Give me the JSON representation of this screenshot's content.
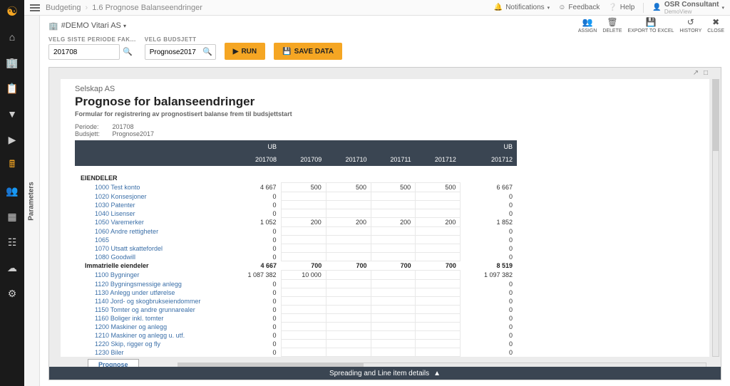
{
  "breadcrumb": {
    "root": "Budgeting",
    "page": "1.6 Prognose Balanseendringer"
  },
  "header_links": {
    "notifications": "Notifications",
    "feedback": "Feedback",
    "help": "Help"
  },
  "user": {
    "name": "OSR Consultant",
    "subtitle": "DemoView"
  },
  "entity": {
    "label": "#DEMO Vitari AS"
  },
  "toolbar": {
    "assign": "ASSIGN",
    "delete": "DELETE",
    "export": "EXPORT TO EXCEL",
    "history": "HISTORY",
    "close": "CLOSE"
  },
  "params_label": "Parameters",
  "filters": {
    "period_label": "VELG SISTE PERIODE FAK...",
    "period_value": "201708",
    "budget_label": "VELG BUDSJETT",
    "budget_value": "Prognose2017"
  },
  "buttons": {
    "run": "RUN",
    "save": "SAVE DATA"
  },
  "report": {
    "company": "Selskap AS",
    "title": "Prognose for balanseendringer",
    "subtitle": "Formular for registrering av prognostisert balanse frem til budsjettstart",
    "meta_period_label": "Periode:",
    "meta_period_value": "201708",
    "meta_budget_label": "Budsjett:",
    "meta_budget_value": "Prognose2017"
  },
  "columns": {
    "ub_start_top": "UB",
    "ub_start": "201708",
    "p1": "201709",
    "p2": "201710",
    "p3": "201711",
    "p4": "201712",
    "ub_end_top": "UB",
    "ub_end": "201712"
  },
  "section1": {
    "title": "EIENDELER"
  },
  "rows": [
    {
      "name": "1000 Test konto",
      "ub_start": "4 667",
      "v1": "500",
      "v2": "500",
      "v3": "500",
      "v4": "500",
      "ub_end": "6 667"
    },
    {
      "name": "1020 Konsesjoner",
      "ub_start": "0",
      "v1": "",
      "v2": "",
      "v3": "",
      "v4": "",
      "ub_end": "0"
    },
    {
      "name": "1030 Patenter",
      "ub_start": "0",
      "v1": "",
      "v2": "",
      "v3": "",
      "v4": "",
      "ub_end": "0"
    },
    {
      "name": "1040 Lisenser",
      "ub_start": "0",
      "v1": "",
      "v2": "",
      "v3": "",
      "v4": "",
      "ub_end": "0"
    },
    {
      "name": "1050 Varemerker",
      "ub_start": "1 052",
      "v1": "200",
      "v2": "200",
      "v3": "200",
      "v4": "200",
      "ub_end": "1 852"
    },
    {
      "name": "1060 Andre rettigheter",
      "ub_start": "0",
      "v1": "",
      "v2": "",
      "v3": "",
      "v4": "",
      "ub_end": "0"
    },
    {
      "name": "1065",
      "ub_start": "0",
      "v1": "",
      "v2": "",
      "v3": "",
      "v4": "",
      "ub_end": "0"
    },
    {
      "name": "1070 Utsatt skattefordel",
      "ub_start": "0",
      "v1": "",
      "v2": "",
      "v3": "",
      "v4": "",
      "ub_end": "0"
    },
    {
      "name": "1080 Goodwill",
      "ub_start": "0",
      "v1": "",
      "v2": "",
      "v3": "",
      "v4": "",
      "ub_end": "0"
    }
  ],
  "subtotal1": {
    "name": "Immatrielle eiendeler",
    "ub_start": "4 667",
    "v1": "700",
    "v2": "700",
    "v3": "700",
    "v4": "700",
    "ub_end": "8 519"
  },
  "rows2": [
    {
      "name": "1100 Bygninger",
      "ub_start": "1 087 382",
      "v1": "10 000",
      "v2": "",
      "v3": "",
      "v4": "",
      "ub_end": "1 097 382"
    },
    {
      "name": "1120 Bygningsmessige anlegg",
      "ub_start": "0",
      "v1": "",
      "v2": "",
      "v3": "",
      "v4": "",
      "ub_end": "0"
    },
    {
      "name": "1130 Anlegg under utførelse",
      "ub_start": "0",
      "v1": "",
      "v2": "",
      "v3": "",
      "v4": "",
      "ub_end": "0"
    },
    {
      "name": "1140 Jord- og skogbrukseiendommer",
      "ub_start": "0",
      "v1": "",
      "v2": "",
      "v3": "",
      "v4": "",
      "ub_end": "0"
    },
    {
      "name": "1150 Tomter og andre grunnarealer",
      "ub_start": "0",
      "v1": "",
      "v2": "",
      "v3": "",
      "v4": "",
      "ub_end": "0"
    },
    {
      "name": "1160 Boliger inkl. tomter",
      "ub_start": "0",
      "v1": "",
      "v2": "",
      "v3": "",
      "v4": "",
      "ub_end": "0"
    },
    {
      "name": "1200 Maskiner og anlegg",
      "ub_start": "0",
      "v1": "",
      "v2": "",
      "v3": "",
      "v4": "",
      "ub_end": "0"
    },
    {
      "name": "1210 Maskiner og anlegg u. utf.",
      "ub_start": "0",
      "v1": "",
      "v2": "",
      "v3": "",
      "v4": "",
      "ub_end": "0"
    },
    {
      "name": "1220 Skip, rigger og fly",
      "ub_start": "0",
      "v1": "",
      "v2": "",
      "v3": "",
      "v4": "",
      "ub_end": "0"
    },
    {
      "name": "1230 Biler",
      "ub_start": "0",
      "v1": "",
      "v2": "",
      "v3": "",
      "v4": "",
      "ub_end": "0"
    }
  ],
  "sheet_tab": "Prognose",
  "bottom_bar": "Spreading and Line item details"
}
